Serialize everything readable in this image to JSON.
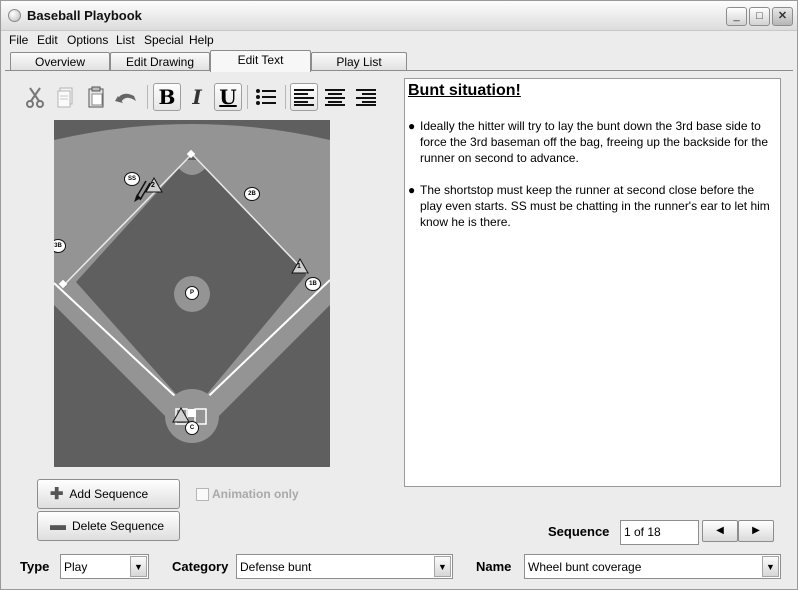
{
  "window": {
    "title": "Baseball Playbook",
    "buttons": [
      "_",
      "□",
      "✕"
    ]
  },
  "menu": [
    "File",
    "Edit",
    "Options",
    "List",
    "Special",
    "Help"
  ],
  "tabs": [
    "Overview",
    "Edit Drawing",
    "Edit Text",
    "Play List"
  ],
  "toolbar": {
    "bold": "B",
    "italic": "I",
    "underline": "U"
  },
  "field": {
    "player_labels": {
      "ss": "SS",
      "second_base": "2B",
      "third_base": "3B",
      "first_base": "1B",
      "pitcher": "P",
      "catcher": "C",
      "marker_2": "2",
      "marker_1": "1"
    }
  },
  "editor": {
    "title": "Bunt situation!",
    "bullets": [
      "Ideally the hitter will try to lay the bunt down the 3rd base side to force the 3rd baseman off the bag, freeing up the backside for the runner on second to advance.",
      "The shortstop must keep the runner at second close before the play even starts.  SS must be chatting in the runner's ear to let him know he is there."
    ]
  },
  "buttons": {
    "add_sequence": "Add Sequence",
    "delete_sequence": "Delete Sequence"
  },
  "animation_only": {
    "label": "Animation only",
    "checked": false
  },
  "sequence": {
    "label": "Sequence",
    "value": "1 of 18"
  },
  "bottom": {
    "type_label": "Type",
    "type_value": "Play",
    "category_label": "Category",
    "category_value": "Defense bunt",
    "name_label": "Name",
    "name_value": "Wheel bunt coverage"
  }
}
